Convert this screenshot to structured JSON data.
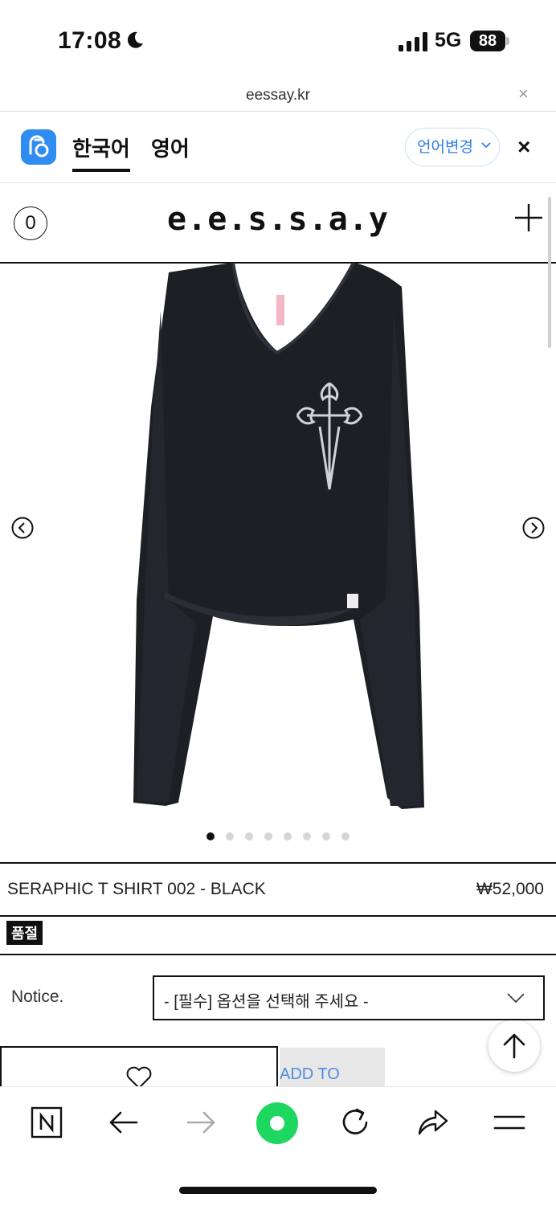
{
  "status_bar": {
    "time": "17:08",
    "network": "5G",
    "battery": "88"
  },
  "url_bar": {
    "domain": "eessay.kr",
    "close": "×"
  },
  "translate_bar": {
    "tabs": [
      "한국어",
      "영어"
    ],
    "change_language": "언어변경",
    "close": "×"
  },
  "site_header": {
    "cart_count": "0",
    "logo": "e.e.s.s.a.y"
  },
  "gallery": {
    "slide_count": 8,
    "active_index": 0
  },
  "product": {
    "name": "SERAPHIC T SHIRT 002 - BLACK",
    "price": "₩52,000",
    "soldout_badge": "품절",
    "notice_label": "Notice.",
    "option_placeholder": "- [필수] 옵션을 선택해 주세요 -",
    "add_to_cart": "ADD TO CART"
  },
  "colors": {
    "accent_blue": "#2f8cf2",
    "naver_green": "#1ed760",
    "text": "#111111"
  }
}
